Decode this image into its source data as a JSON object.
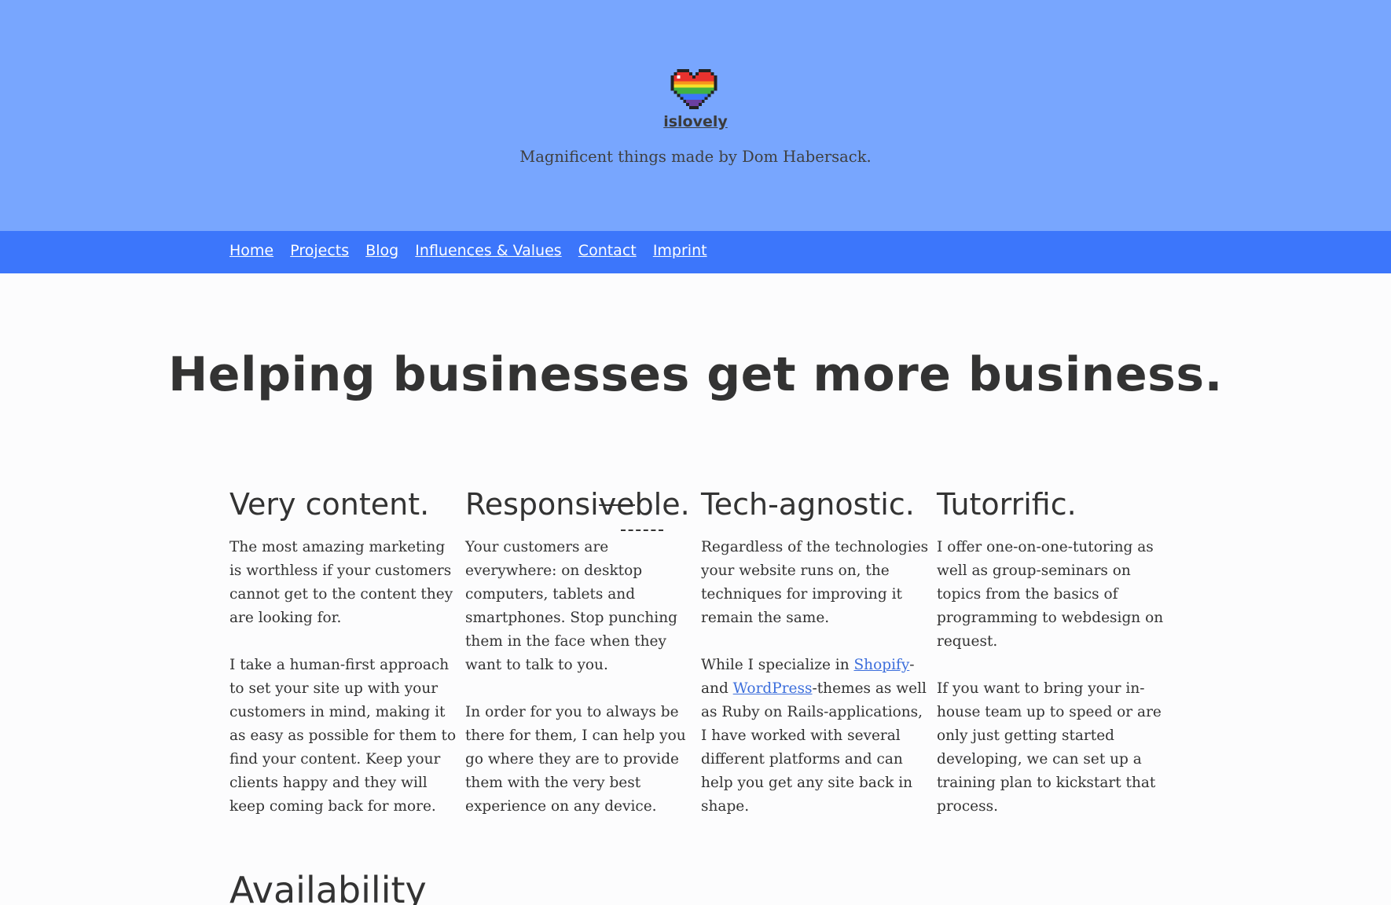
{
  "header": {
    "logo_icon": "rainbow-pixel-heart-icon",
    "site_name": "islovely",
    "tagline": "Magnificent things made by Dom Habersack.",
    "background": "#78a6fe"
  },
  "nav": {
    "background": "#3c76fb",
    "items": [
      {
        "label": "Home"
      },
      {
        "label": "Projects"
      },
      {
        "label": "Blog"
      },
      {
        "label": "Influences & Values"
      },
      {
        "label": "Contact"
      },
      {
        "label": "Imprint"
      }
    ]
  },
  "main": {
    "headline": "Helping businesses get more business.",
    "columns": [
      {
        "title": "Very content.",
        "paragraphs": [
          "The most amazing marketing is worthless if your customers cannot get to the content they are looking for.",
          "I take a human-first approach to set your site up with your customers in mind, making it as easy as possible for them to find your content. Keep your clients happy and they will keep coming back for more."
        ]
      },
      {
        "title_prefix": "Responsi",
        "title_struck": "ve",
        "title_suffix": "ble.",
        "paragraphs": [
          "Your customers are everywhere: on desktop computers, tablets and smartphones. Stop punching them in the face when they want to talk to you.",
          "In order for you to always be there for them, I can help you go where they are to provide them with the very best experience on any device."
        ]
      },
      {
        "title": "Tech-agnostic.",
        "paragraph1": "Regardless of the technologies your website runs on, the techniques for improving it remain the same.",
        "p2_before": "While I specialize in ",
        "p2_link1": "Shopify",
        "p2_between": "-and ",
        "p2_link2": "WordPress",
        "p2_after": "-themes as well as Ruby on Rails-applications, I have worked with several different platforms and can help you get any site back in shape."
      },
      {
        "title": "Tutorrific.",
        "paragraphs": [
          "I offer one-on-one-tutoring as well as group-seminars on topics from the basics of programming to webdesign on request.",
          "If you want to bring your in-house team up to speed or are only just getting started developing, we can set up a training plan to kickstart that process."
        ]
      }
    ],
    "section_heading": "Availability"
  }
}
